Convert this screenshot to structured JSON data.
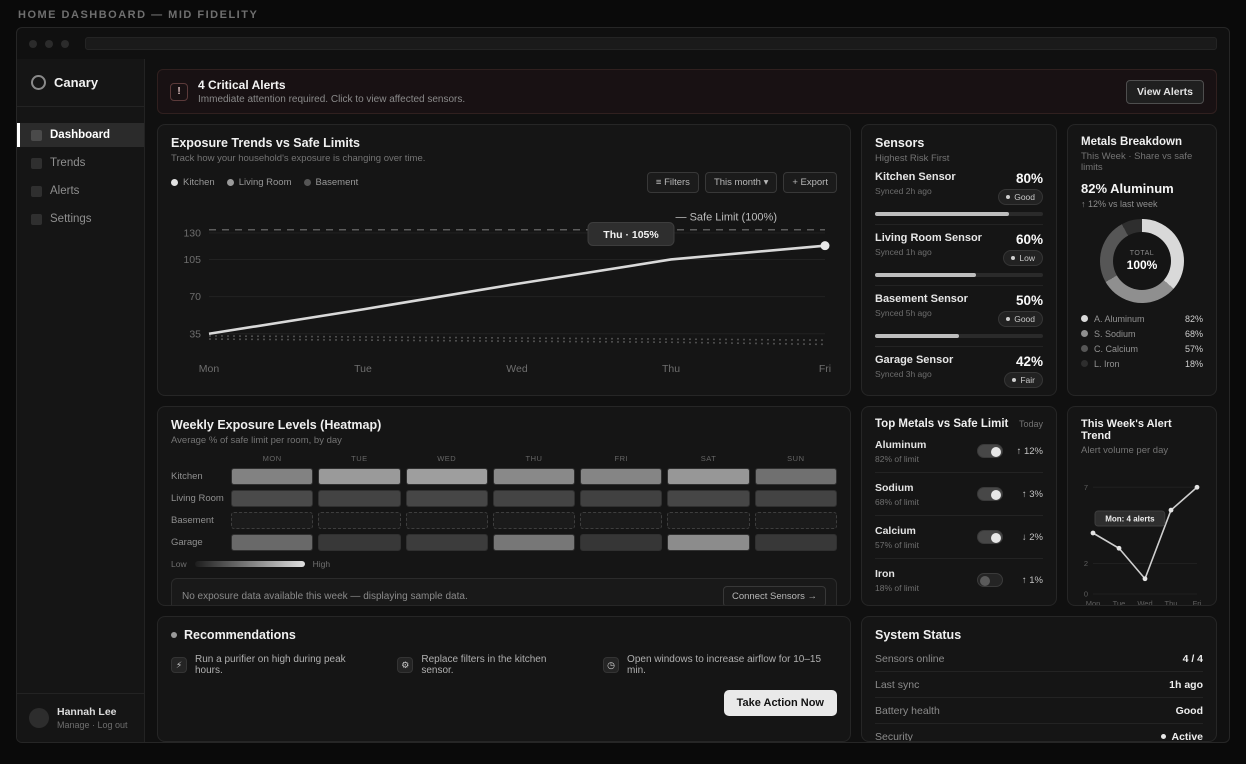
{
  "chrome": {
    "page_title": "HOME DASHBOARD — MID FIDELITY"
  },
  "sidebar": {
    "brand": "Canary",
    "nav": [
      {
        "label": "Dashboard"
      },
      {
        "label": "Trends"
      },
      {
        "label": "Alerts"
      },
      {
        "label": "Settings"
      }
    ],
    "user": {
      "name": "Hannah Lee",
      "meta": "Manage · Log out"
    }
  },
  "alert_banner": {
    "icon": "!",
    "title": "4 Critical Alerts",
    "subtitle": "Immediate attention required. Click to view affected sensors.",
    "button_label": "View Alerts"
  },
  "exposure_trends": {
    "title": "Exposure Trends vs Safe Limits",
    "subtitle": "Track how your household's exposure is changing over time.",
    "legend": [
      {
        "label": "Kitchen",
        "color": "#e2e2e2"
      },
      {
        "label": "Living Room",
        "color": "#9a9a9a"
      },
      {
        "label": "Basement",
        "color": "#555555"
      }
    ],
    "filters_button": "≡ Filters",
    "period_button": "This month ▾",
    "export_button": "+ Export",
    "safe_limit_label": "— Safe Limit (100%)",
    "chart_data": {
      "type": "line",
      "x": [
        "Mon",
        "Tue",
        "Wed",
        "Thu",
        "Fri"
      ],
      "series": [
        {
          "name": "Kitchen",
          "values": [
            35,
            58,
            82,
            105,
            118
          ],
          "style": "solid"
        },
        {
          "name": "Living Room",
          "values": [
            33,
            32,
            31,
            30,
            29
          ],
          "style": "dotted"
        },
        {
          "name": "Basement",
          "values": [
            30,
            29,
            28,
            27,
            25
          ],
          "style": "dotted"
        }
      ],
      "safe_limit": 133,
      "yticks": [
        130,
        105,
        70,
        35
      ],
      "ylim": [
        15,
        145
      ],
      "grid": true,
      "tooltip": {
        "x_index": 3,
        "text": "Thu · 105%"
      }
    }
  },
  "sensors": {
    "title": "Sensors",
    "subtitle": "Highest Risk First",
    "items": [
      {
        "name": "Kitchen Sensor",
        "synced": "Synced 2h ago",
        "value": "80%",
        "percent": 80,
        "status": "Good"
      },
      {
        "name": "Living Room Sensor",
        "synced": "Synced 1h ago",
        "value": "60%",
        "percent": 60,
        "status": "Low"
      },
      {
        "name": "Basement Sensor",
        "synced": "Synced 5h ago",
        "value": "50%",
        "percent": 50,
        "status": "Good"
      },
      {
        "name": "Garage Sensor",
        "synced": "Synced 3h ago",
        "value": "42%",
        "percent": 42,
        "status": "Fair"
      }
    ]
  },
  "metals_breakdown": {
    "title": "Metals Breakdown",
    "subtitle": "This Week · Share vs safe limits",
    "headline": "82% Aluminum",
    "delta": "↑ 12% vs last week",
    "donut_center_top": "TOTAL",
    "donut_center_value": "100%",
    "chart_data": {
      "type": "pie",
      "slices": [
        {
          "label": "A. Aluminum",
          "value": 82,
          "color": "#d9d9d9"
        },
        {
          "label": "S. Sodium",
          "value": 68,
          "color": "#8f8f8f"
        },
        {
          "label": "C. Calcium",
          "value": 57,
          "color": "#565656"
        },
        {
          "label": "L. Iron",
          "value": 18,
          "color": "#2e2e2e"
        }
      ],
      "center_label": "TOTAL 100%"
    },
    "legend": [
      {
        "label": "A. Aluminum",
        "value": "82%"
      },
      {
        "label": "S. Sodium",
        "value": "68%"
      },
      {
        "label": "C. Calcium",
        "value": "57%"
      },
      {
        "label": "L. Iron",
        "value": "18%"
      }
    ]
  },
  "heatmap": {
    "title": "Weekly Exposure Levels (Heatmap)",
    "subtitle": "Average % of safe limit per room, by day",
    "days": [
      "MON",
      "TUE",
      "WED",
      "THU",
      "FRI",
      "SAT",
      "SUN"
    ],
    "chart_data": {
      "type": "heatmap",
      "x": [
        "MON",
        "TUE",
        "WED",
        "THU",
        "FRI",
        "SAT",
        "SUN"
      ],
      "rows": [
        {
          "label": "Kitchen",
          "values": [
            58,
            72,
            74,
            62,
            60,
            70,
            48
          ]
        },
        {
          "label": "Living Room",
          "values": [
            26,
            22,
            24,
            23,
            21,
            24,
            22
          ]
        },
        {
          "label": "Basement",
          "values": [
            10,
            9,
            10,
            9,
            8,
            9,
            8
          ],
          "sample": true
        },
        {
          "label": "Garage",
          "values": [
            44,
            16,
            18,
            52,
            15,
            64,
            16
          ]
        }
      ],
      "scale": {
        "low_label": "Low",
        "high_label": "High"
      }
    },
    "note": "No exposure data available this week — displaying sample data.",
    "connect_button": "Connect Sensors →"
  },
  "top_metals": {
    "title": "Top Metals vs Safe Limit",
    "period": "Today",
    "items": [
      {
        "name": "Aluminum",
        "limit": "82% of limit",
        "trend": "↑ 12%",
        "enabled": true
      },
      {
        "name": "Sodium",
        "limit": "68% of limit",
        "trend": "↑ 3%",
        "enabled": true
      },
      {
        "name": "Calcium",
        "limit": "57% of limit",
        "trend": "↓ 2%",
        "enabled": true
      },
      {
        "name": "Iron",
        "limit": "18% of limit",
        "trend": "↑ 1%",
        "enabled": false
      }
    ]
  },
  "alert_trend": {
    "title": "This Week's Alert Trend",
    "subtitle": "Alert volume per day",
    "chart_data": {
      "type": "line",
      "x": [
        "Mon",
        "Tue",
        "Wed",
        "Thu",
        "Fri"
      ],
      "values": [
        4,
        3,
        1,
        5.5,
        7
      ],
      "ylim": [
        0,
        8
      ],
      "yticks": [
        7,
        2,
        0
      ],
      "tooltip": {
        "x_index": 0,
        "text": "Mon: 4 alerts"
      }
    }
  },
  "recommendations": {
    "title": "Recommendations",
    "items": [
      {
        "icon": "⚡",
        "text": "Run a purifier on high during peak hours."
      },
      {
        "icon": "⚙",
        "text": "Replace filters in the kitchen sensor."
      },
      {
        "icon": "◷",
        "text": "Open windows to increase airflow for 10–15 min."
      }
    ],
    "action_button": "Take Action Now"
  },
  "system_status": {
    "title": "System Status",
    "rows": [
      {
        "label": "Sensors online",
        "value": "4 / 4"
      },
      {
        "label": "Last sync",
        "value": "1h ago"
      },
      {
        "label": "Battery health",
        "value": "Good"
      },
      {
        "label": "Security",
        "value": "Active",
        "dot": true
      }
    ]
  },
  "colors": {
    "accent_light": "#e9e9e9",
    "card_bg": "#151515",
    "border": "#262626"
  }
}
